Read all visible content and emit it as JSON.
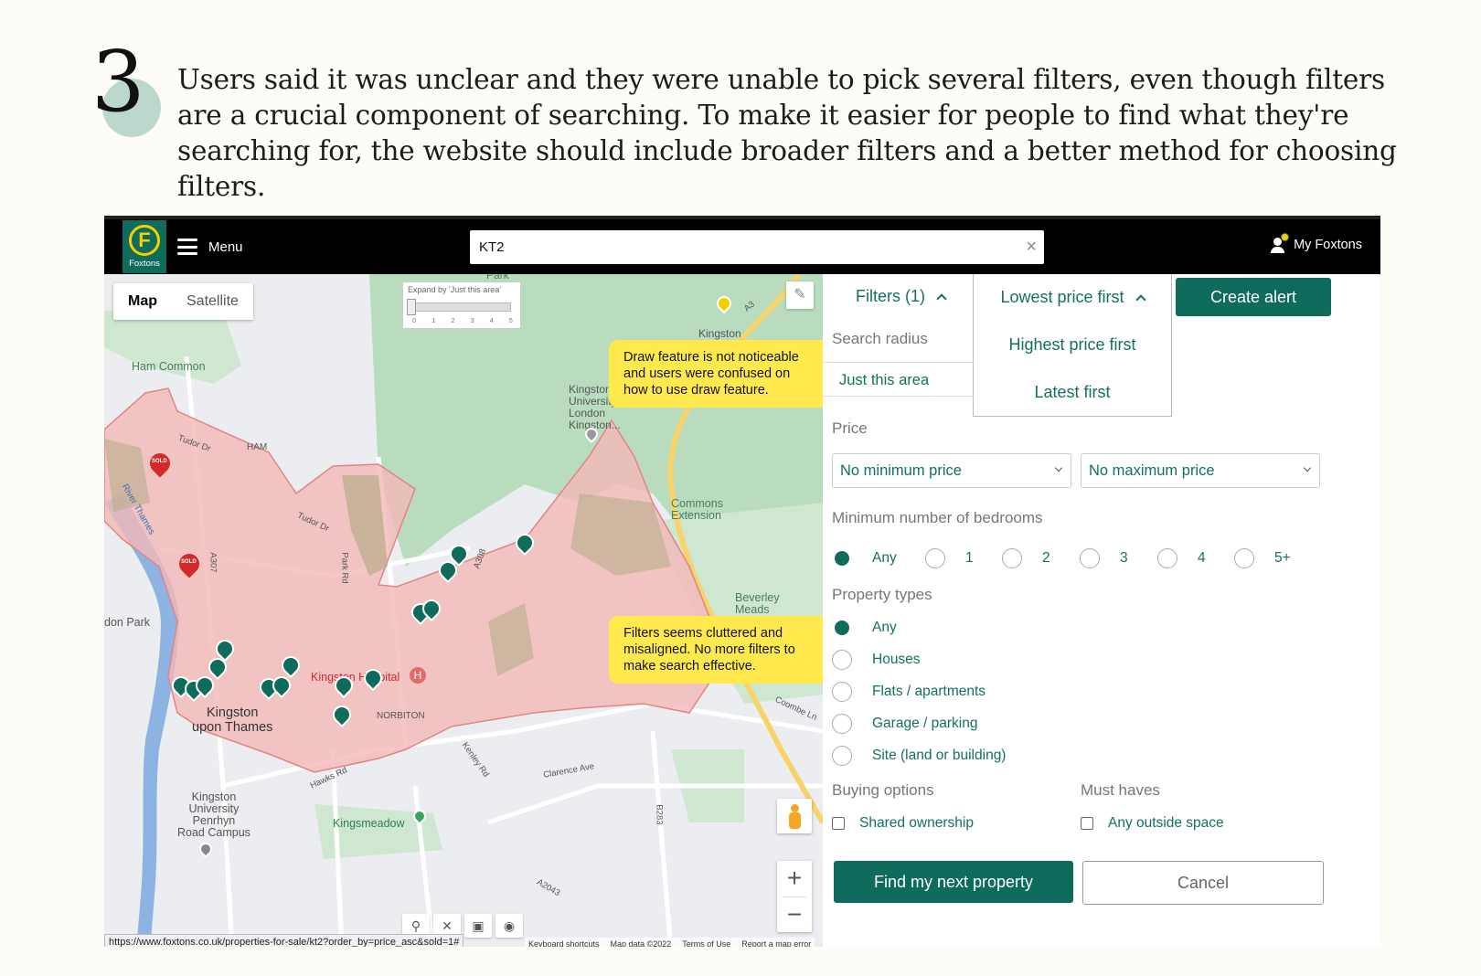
{
  "intro": {
    "step_number": "3",
    "text": "Users said it was unclear and they were unable to pick several filters, even though filters are a crucial component of searching. To make it easier for people to find what they're searching for, the website should include broader filters and a better method for choosing filters."
  },
  "topbar": {
    "logo_letter": "F",
    "logo_text": "Foxtons",
    "menu_label": "Menu",
    "search_value": "KT2",
    "clear_symbol": "×",
    "account_label": "My Foxtons"
  },
  "map": {
    "tab_map": "Map",
    "tab_satellite": "Satellite",
    "expand_label": "Expand by 'Just this area'",
    "expand_ticks": [
      "0",
      "1",
      "2",
      "3",
      "4",
      "5"
    ],
    "places": {
      "ham_common": "Ham Common",
      "ham": "HAM",
      "kingston_uni": "Kingston\nUniversity\nLondon\nKingston...",
      "commons_extension": "Commons\nExtension",
      "beverley_meads": "Beverley\nMeads",
      "kingston_hospital": "Kingston Hospital",
      "kingston_upon_thames": "Kingston\nupon Thames",
      "norbiton": "NORBITON",
      "penrhyn": "Kingston\nUniversity\nPenrhyn\nRoad Campus",
      "kingsmeadow": "Kingsmeadow",
      "don_park": "don Park",
      "park": "Park",
      "kingston": "Kingston"
    },
    "roads": {
      "tudor_dr": "Tudor Dr",
      "park_rd": "Park Rd",
      "a308": "A308",
      "a307": "A307",
      "river_thames": "River Thames",
      "coombe_ln": "Coombe Ln",
      "kenley_rd": "Kenley Rd",
      "clarence_ave": "Clarence Ave",
      "hawks_rd": "Hawks Rd",
      "a2043": "A2043",
      "b283": "B283",
      "a3": "A3"
    },
    "badge_sold": "SOLD",
    "hospital_marker": "H",
    "callout_draw": "Draw feature is not noticeable and users were confused on how to use draw feature.",
    "callout_filters": "Filters seems cluttered and misaligned. No more filters to make search effective.",
    "zoom_in": "+",
    "zoom_out": "−",
    "footer": {
      "shortcuts": "Keyboard shortcuts",
      "map_data": "Map data ©2022",
      "terms": "Terms of Use",
      "report": "Report a map error"
    },
    "status_url": "https://www.foxtons.co.uk/properties-for-sale/kt2?order_by=price_asc&sold=1#"
  },
  "panel": {
    "filters_label": "Filters (1)",
    "sort_options": [
      "Lowest price first",
      "Highest price first",
      "Latest first"
    ],
    "create_alert": "Create alert",
    "search_radius_label": "Search radius",
    "search_radius_value": "Just this area",
    "price_label": "Price",
    "min_price": "No minimum price",
    "max_price": "No maximum price",
    "bedrooms_label": "Minimum number of bedrooms",
    "bedroom_options": [
      "Any",
      "1",
      "2",
      "3",
      "4",
      "5+"
    ],
    "bedroom_selected": "Any",
    "property_types_label": "Property types",
    "property_types": [
      "Any",
      "Houses",
      "Flats / apartments",
      "Garage / parking",
      "Site (land or building)"
    ],
    "property_type_selected": "Any",
    "buying_options_label": "Buying options",
    "buying_option": "Shared ownership",
    "must_haves_label": "Must haves",
    "must_have": "Any outside space",
    "find_button": "Find my next property",
    "cancel_button": "Cancel"
  },
  "colors": {
    "brand_green": "#0f6b5c",
    "brand_yellow": "#f5d000",
    "callout_yellow": "#ffe94d",
    "area_fill": "#f4b8b8"
  }
}
